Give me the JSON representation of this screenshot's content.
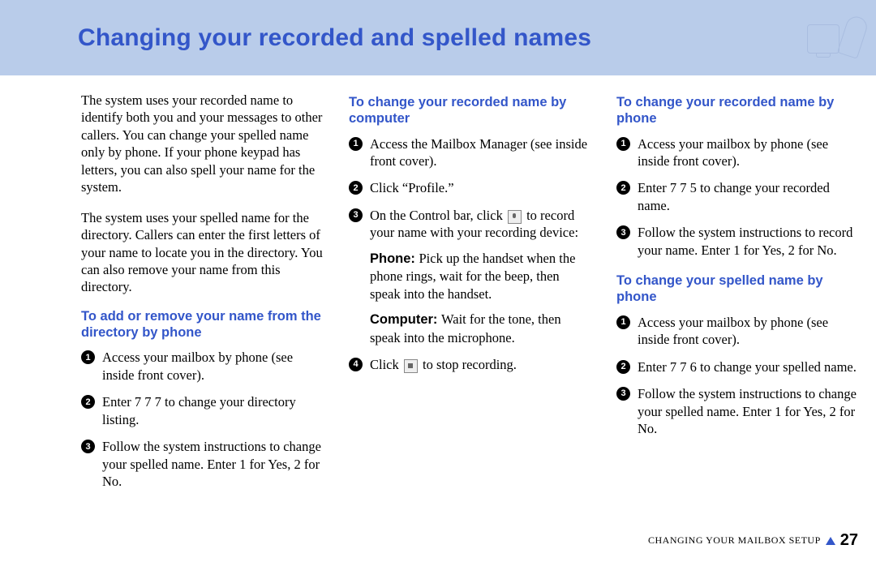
{
  "header": {
    "title": "Changing your recorded and spelled names"
  },
  "col1": {
    "intro_p1": "The system uses your recorded name to identify both you and your messages to other callers. You can change your spelled name only by phone. If your phone keypad has letters, you can also spell your name for the system.",
    "intro_p2": "The system uses your spelled name for the directory. Callers can enter the first letters of your name to locate you in the directory. You can also remove your name from this directory.",
    "heading1": "To add or remove your name from the directory by phone",
    "steps1": {
      "s1": "Access your mailbox by phone (see inside front cover).",
      "s2": "Enter 7 7 7 to change your directory listing.",
      "s3": "Follow the system instructions to change your spelled name. Enter 1 for Yes, 2 for No."
    }
  },
  "col2": {
    "heading1": "To change your recorded name by computer",
    "steps1": {
      "s1": "Access the Mailbox Manager (see inside front cover).",
      "s2": "Click “Profile.”",
      "s3a": "On the Control bar, click ",
      "s3b": " to record your name with your record­ing device:",
      "s3_phone_label": "Phone: ",
      "s3_phone": "Pick up the handset when the phone rings, wait for the beep, then speak into the handset.",
      "s3_comp_label": "Computer: ",
      "s3_comp": "Wait for the tone, then speak into the microphone.",
      "s4a": "Click ",
      "s4b": " to stop recording."
    }
  },
  "col3": {
    "heading1": "To change your recorded name by phone",
    "steps1": {
      "s1": "Access your mailbox by phone (see inside front cover).",
      "s2": "Enter 7 7 5 to change your recorded name.",
      "s3": "Follow the system instructions to record your name. Enter 1 for Yes, 2 for No."
    },
    "heading2": "To change your spelled name by phone",
    "steps2": {
      "s1": "Access your mailbox by phone (see inside front cover).",
      "s2": "Enter 7 7 6 to change your spelled name.",
      "s3": "Follow the system instructions to change your spelled name. Enter 1 for Yes, 2 for No."
    }
  },
  "footer": {
    "section": "CHANGING YOUR MAILBOX SETUP",
    "page": "27"
  }
}
